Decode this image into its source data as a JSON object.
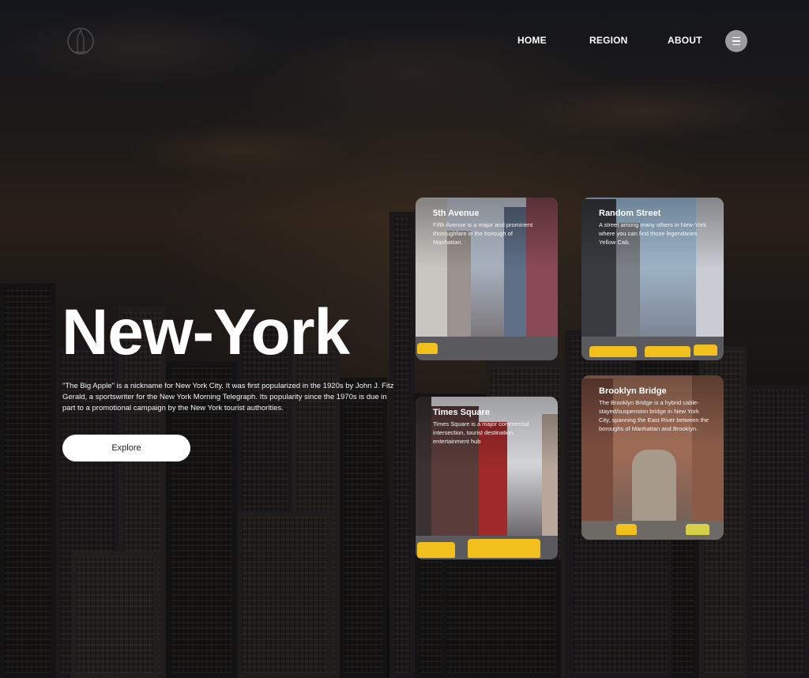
{
  "nav": {
    "items": [
      {
        "label": "HOME"
      },
      {
        "label": "REGION"
      },
      {
        "label": "ABOUT"
      }
    ]
  },
  "hero": {
    "title": "New-York",
    "description": "\"The Big Apple\" is a nickname for New York City. It was first popularized in the 1920s by John J. Fitz Gerald, a sportswriter for the New York Morning Telegraph. Its popularity since the 1970s is due in part to a promotional campaign by the New York tourist authorities.",
    "button_label": "Explore"
  },
  "cards": [
    {
      "title": "5th Avenue",
      "text": "Fifth Avenue is a major and prominent thoroughfare in the borough of Manhattan."
    },
    {
      "title": "Random Street",
      "text": "A street among many others in New-York where you can find those legendaries Yellow Cab."
    },
    {
      "title": "Times Square",
      "text": "Times Square is a major commercial intersection, tourist destination, entertainment hub"
    },
    {
      "title": "Brooklyn Bridge",
      "text": "The Brooklyn Bridge is a hybrid cable-stayed/suspension bridge in New York City, spanning the East River between the boroughs of Manhattan and Brooklyn."
    }
  ],
  "colors": {
    "accent_taxi": "#f2c01c",
    "button_bg": "#ffffff",
    "menu_button_bg": "#c8c8cd"
  },
  "icons": {
    "logo": "building-logo-icon",
    "menu": "hamburger-menu-icon"
  }
}
